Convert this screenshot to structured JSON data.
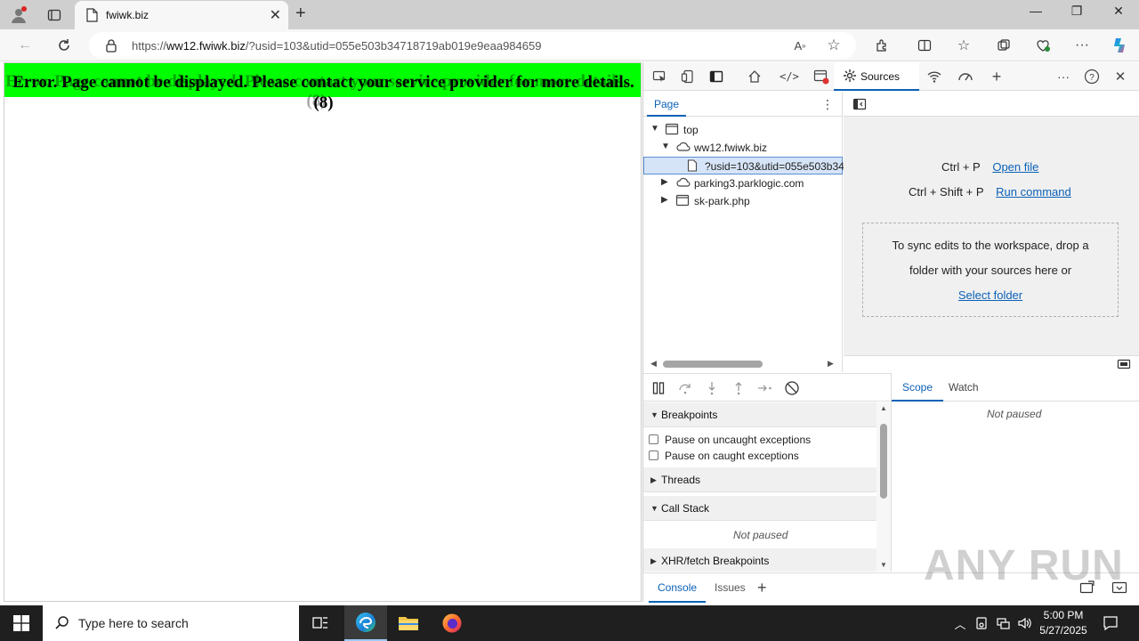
{
  "browser": {
    "tab_title": "fwiwk.biz",
    "url_prefix": "https://",
    "url_domain": "ww12.fwiwk.biz",
    "url_path": "/?usid=103&utid=055e503b34718719ab019e9eaa984659"
  },
  "page": {
    "error_message": "Error. Page cannot be displayed. Please contact your service provider for more details. (8)",
    "banner_color": "#00ff00"
  },
  "devtools": {
    "tab_sources": "Sources",
    "nav_tab": "Page",
    "tree": {
      "top": "top",
      "domain1": "ww12.fwiwk.biz",
      "file1": "?usid=103&utid=055e503b34",
      "domain2": "parking3.parklogic.com",
      "frame": "sk-park.php"
    },
    "shortcuts": {
      "open_key": "Ctrl + P",
      "open_label": "Open file",
      "run_key": "Ctrl + Shift + P",
      "run_label": "Run command"
    },
    "dropzone": {
      "line1": "To sync edits to the workspace, drop a",
      "line2": "folder with your sources here or",
      "link": "Select folder"
    },
    "sections": {
      "breakpoints": "Breakpoints",
      "pause_uncaught": "Pause on uncaught exceptions",
      "pause_caught": "Pause on caught exceptions",
      "threads": "Threads",
      "call_stack": "Call Stack",
      "not_paused": "Not paused",
      "xhr": "XHR/fetch Breakpoints"
    },
    "scope_tabs": {
      "scope": "Scope",
      "watch": "Watch",
      "not_paused": "Not paused"
    },
    "drawer": {
      "console": "Console",
      "issues": "Issues"
    },
    "accent": "#0b61b8"
  },
  "watermark": "ANY RUN",
  "taskbar": {
    "search_placeholder": "Type here to search",
    "time": "5:00 PM",
    "date": "5/27/2025"
  }
}
